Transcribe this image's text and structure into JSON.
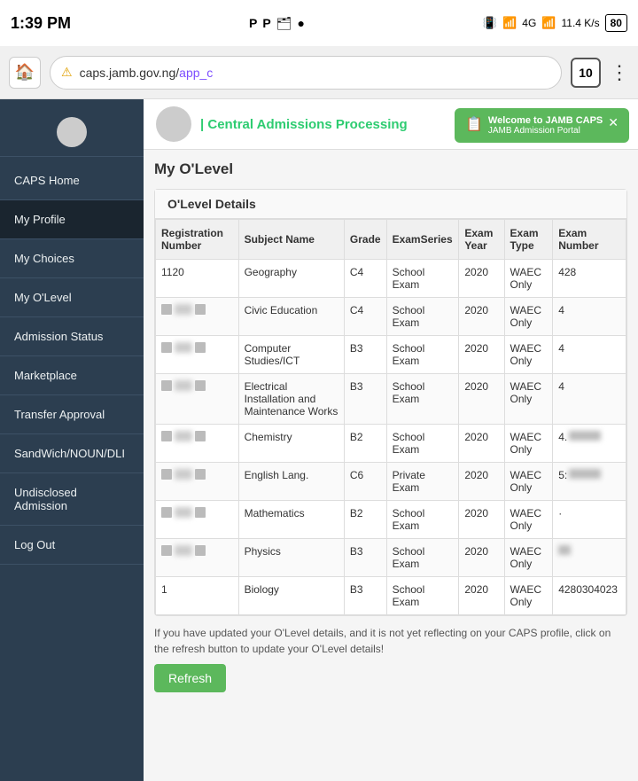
{
  "status_bar": {
    "time": "1:39 PM",
    "network": "4G",
    "speed": "11.4 K/s",
    "battery": "80"
  },
  "browser": {
    "url": "caps.jamb.gov.ng/app_c",
    "url_scheme": "caps.jamb.gov.ng/",
    "url_path": "app_c",
    "tab_count": "10"
  },
  "notification": {
    "title": "Welcome to JAMB CAPS",
    "subtitle": "JAMB Admission Portal"
  },
  "header": {
    "title": "| Central Admissions Processing"
  },
  "sidebar": {
    "items": [
      {
        "label": "CAPS Home",
        "id": "caps-home"
      },
      {
        "label": "My Profile",
        "id": "my-profile"
      },
      {
        "label": "My Choices",
        "id": "my-choices"
      },
      {
        "label": "My O'Level",
        "id": "my-olevel"
      },
      {
        "label": "Admission Status",
        "id": "admission-status"
      },
      {
        "label": "Marketplace",
        "id": "marketplace"
      },
      {
        "label": "Transfer Approval",
        "id": "transfer-approval"
      },
      {
        "label": "SandWich/NOUN/DLI",
        "id": "sandwich"
      },
      {
        "label": "Undisclosed Admission",
        "id": "undisclosed-admission"
      },
      {
        "label": "Log Out",
        "id": "log-out"
      }
    ]
  },
  "page": {
    "heading": "My O'Level",
    "card_header": "O'Level Details"
  },
  "table": {
    "columns": [
      "Registration Number",
      "Subject Name",
      "Grade",
      "ExamSeries",
      "Exam Year",
      "Exam Type",
      "Exam Number"
    ],
    "rows": [
      {
        "reg": "1120",
        "subject": "Geography",
        "grade": "C4",
        "series": "School Exam",
        "year": "2020",
        "type": "WAEC Only",
        "number": "428"
      },
      {
        "reg": "",
        "subject": "Civic Education",
        "grade": "C4",
        "series": "School Exam",
        "year": "2020",
        "type": "WAEC Only",
        "number": "4"
      },
      {
        "reg": "",
        "subject": "Computer Studies/ICT",
        "grade": "B3",
        "series": "School Exam",
        "year": "2020",
        "type": "WAEC Only",
        "number": "4"
      },
      {
        "reg": "",
        "subject": "Electrical Installation and Maintenance Works",
        "grade": "B3",
        "series": "School Exam",
        "year": "2020",
        "type": "WAEC Only",
        "number": "4"
      },
      {
        "reg": "",
        "subject": "Chemistry",
        "grade": "B2",
        "series": "School Exam",
        "year": "2020",
        "type": "WAEC Only",
        "number": "4."
      },
      {
        "reg": "",
        "subject": "English Lang.",
        "grade": "C6",
        "series": "Private Exam",
        "year": "2020",
        "type": "WAEC Only",
        "number": "5:"
      },
      {
        "reg": "",
        "subject": "Mathematics",
        "grade": "B2",
        "series": "School Exam",
        "year": "2020",
        "type": "WAEC Only",
        "number": "·"
      },
      {
        "reg": "",
        "subject": "Physics",
        "grade": "B3",
        "series": "School Exam",
        "year": "2020",
        "type": "WAEC Only",
        "number": ""
      },
      {
        "reg": "1",
        "subject": "Biology",
        "grade": "B3",
        "series": "School Exam",
        "year": "2020",
        "type": "WAEC Only",
        "number": "4280304023"
      }
    ]
  },
  "footer": {
    "note": "If you have updated your O'Level details, and it is not yet reflecting on your CAPS profile, click on the refresh button to update your O'Level details!",
    "refresh_label": "Refresh"
  }
}
